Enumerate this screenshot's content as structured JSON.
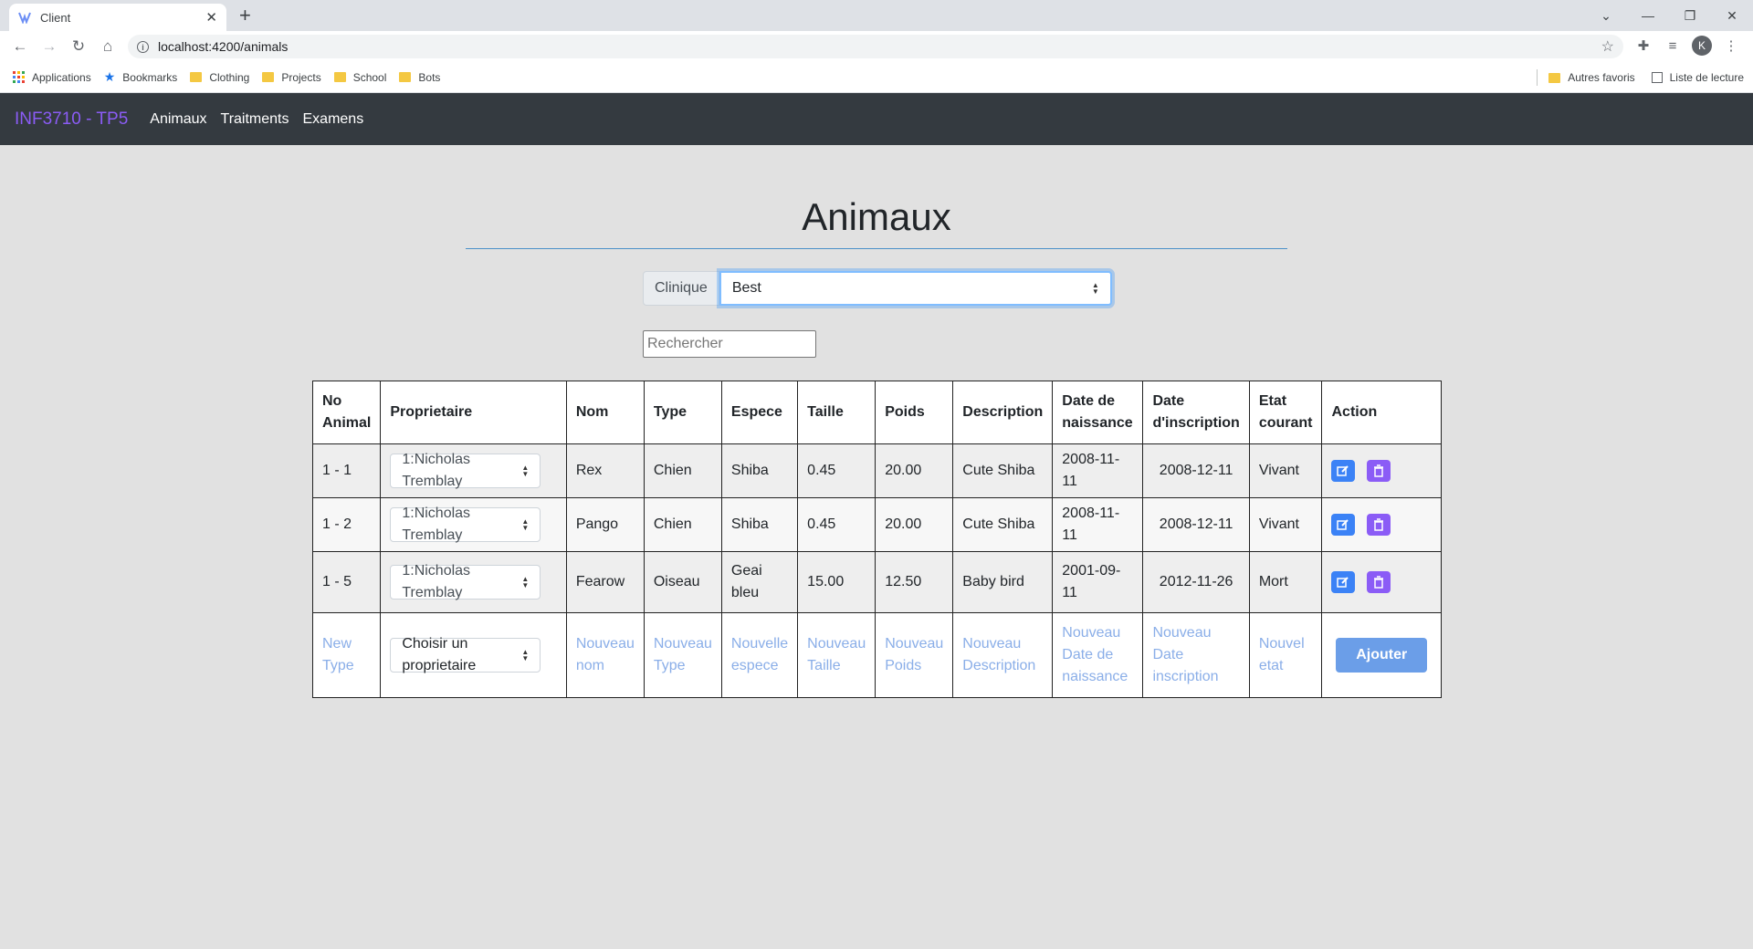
{
  "browser": {
    "tab_title": "Client",
    "url": "localhost:4200/animals",
    "bookmarks": [
      "Applications",
      "Bookmarks",
      "Clothing",
      "Projects",
      "School",
      "Bots"
    ],
    "other_bookmarks": "Autres favoris",
    "reading_list": "Liste de lecture",
    "profile_initial": "K"
  },
  "navbar": {
    "brand": "INF3710 - TP5",
    "links": [
      "Animaux",
      "Traitments",
      "Examens"
    ]
  },
  "page": {
    "title": "Animaux",
    "clinic_label": "Clinique",
    "clinic_value": "Best",
    "search_placeholder": "Rechercher"
  },
  "table": {
    "headers": [
      "No Animal",
      "Proprietaire",
      "Nom",
      "Type",
      "Espece",
      "Taille",
      "Poids",
      "Description",
      "Date de naissance",
      "Date d'inscription",
      "Etat courant",
      "Action"
    ],
    "rows": [
      {
        "no": "1 - 1",
        "owner": "1:Nicholas Tremblay",
        "nom": "Rex",
        "type": "Chien",
        "espece": "Shiba",
        "taille": "0.45",
        "poids": "20.00",
        "description": "Cute Shiba",
        "naissance": "2008-11-11",
        "inscription": "2008-12-11",
        "etat": "Vivant"
      },
      {
        "no": "1 - 2",
        "owner": "1:Nicholas Tremblay",
        "nom": "Pango",
        "type": "Chien",
        "espece": "Shiba",
        "taille": "0.45",
        "poids": "20.00",
        "description": "Cute Shiba",
        "naissance": "2008-11-11",
        "inscription": "2008-12-11",
        "etat": "Vivant"
      },
      {
        "no": "1 - 5",
        "owner": "1:Nicholas Tremblay",
        "nom": "Fearow",
        "type": "Oiseau",
        "espece": "Geai bleu",
        "taille": "15.00",
        "poids": "12.50",
        "description": "Baby bird",
        "naissance": "2001-09-11",
        "inscription": "2012-11-26",
        "etat": "Mort"
      }
    ],
    "new_row": {
      "no": "New Type",
      "owner": "Choisir un proprietaire",
      "nom": "Nouveau nom",
      "type": "Nouveau Type",
      "espece": "Nouvelle espece",
      "taille": "Nouveau Taille",
      "poids": "Nouveau Poids",
      "description": "Nouveau Description",
      "naissance": "Nouveau Date de naissance",
      "inscription": "Nouveau Date inscription",
      "etat": "Nouvel etat",
      "add_label": "Ajouter"
    }
  },
  "colors": {
    "navbar_bg": "#343a40",
    "brand": "#8b5cf6",
    "edit_button": "#3b82f6",
    "delete_button": "#8b5cf6",
    "add_button": "#6b9ee8",
    "placeholder_text": "#8aaee8"
  }
}
